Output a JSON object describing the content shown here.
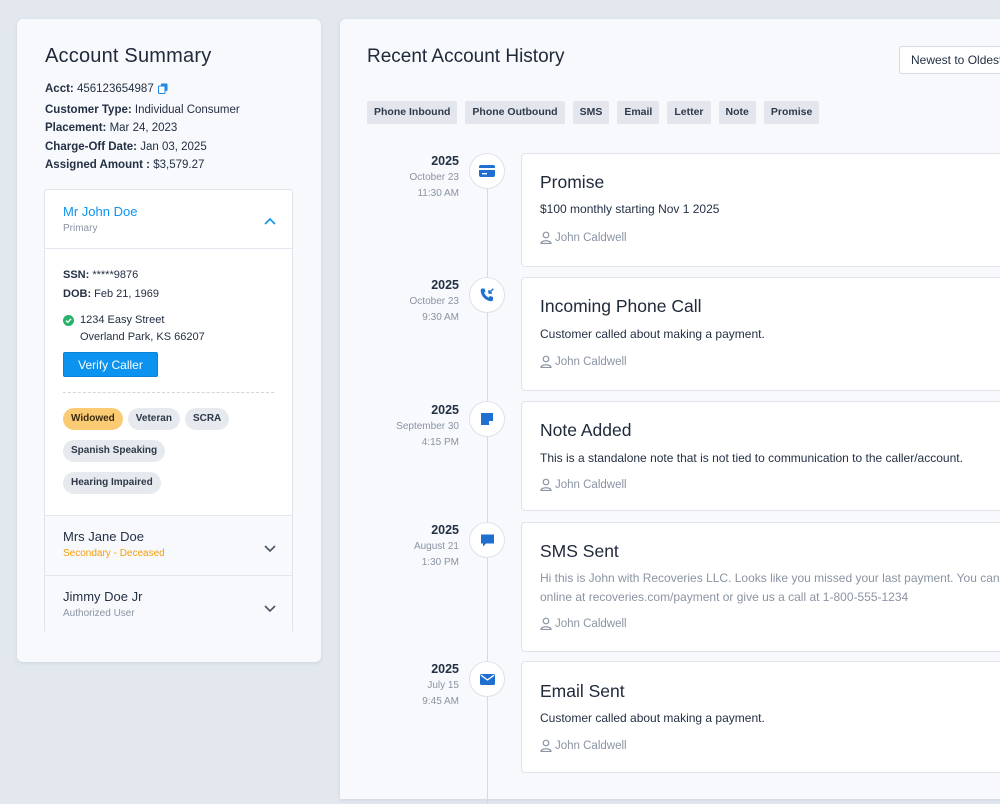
{
  "summary": {
    "title": "Account Summary",
    "acct_label": "Acct:",
    "acct_value": "456123654987",
    "customer_type_label": "Customer Type:",
    "customer_type_value": "Individual Consumer",
    "placement_label": "Placement:",
    "placement_value": "Mar 24, 2023",
    "chargeoff_label": "Charge-Off Date:",
    "chargeoff_value": "Jan 03, 2025",
    "assigned_label": "Assigned Amount :",
    "assigned_value": "$3,579.27"
  },
  "contacts": {
    "primary": {
      "name": "Mr John Doe",
      "role": "Primary",
      "ssn_label": "SSN:",
      "ssn_value": "*****9876",
      "dob_label": "DOB:",
      "dob_value": "Feb 21, 1969",
      "address_line1": "1234 Easy Street",
      "address_line2": "Overland Park, KS 66207",
      "verify_label": "Verify Caller",
      "tags": [
        "Widowed",
        "Veteran",
        "SCRA",
        "Spanish Speaking",
        "Hearing Impaired"
      ]
    },
    "secondary": {
      "name": "Mrs Jane Doe",
      "role": "Secondary - Deceased"
    },
    "authorized": {
      "name": "Jimmy Doe Jr",
      "role": "Authorized User"
    }
  },
  "history": {
    "title": "Recent Account History",
    "sort_label": "Newest to Oldest",
    "filters": [
      "Phone Inbound",
      "Phone Outbound",
      "SMS",
      "Email",
      "Letter",
      "Note",
      "Promise"
    ],
    "events": [
      {
        "year": "2025",
        "date": "October 23",
        "time": "11:30 AM",
        "icon": "credit-card-icon",
        "title": "Promise",
        "desc": "$100 monthly starting Nov 1 2025",
        "desc2": "",
        "user": "John Caldwell"
      },
      {
        "year": "2025",
        "date": "October 23",
        "time": "9:30 AM",
        "icon": "phone-incoming-icon",
        "title": "Incoming Phone Call",
        "desc": "Customer called about making a payment.",
        "desc2": "",
        "user": "John Caldwell"
      },
      {
        "year": "2025",
        "date": "September 30",
        "time": "4:15 PM",
        "icon": "sticky-note-icon",
        "title": "Note Added",
        "desc": "This is a standalone note that is not tied to communication to the caller/account.",
        "desc2": "",
        "user": "John Caldwell"
      },
      {
        "year": "2025",
        "date": "August 21",
        "time": "1:30 PM",
        "icon": "chat-bubble-icon",
        "title": "SMS Sent",
        "desc": "Hi this is John with Recoveries LLC. Looks like you missed your last payment. You can pay",
        "desc2": "online at recoveries.com/payment or give us a call at 1-800-555-1234",
        "user": "John Caldwell"
      },
      {
        "year": "2025",
        "date": "July 15",
        "time": "9:45 AM",
        "icon": "envelope-icon",
        "title": "Email Sent",
        "desc": "Customer called about making a payment.",
        "desc2": "",
        "user": "John Caldwell"
      }
    ]
  },
  "colors": {
    "accent": "#0c93f0",
    "warning": "#f59e0b",
    "success": "#27b36a",
    "tag_warn": "#fbcb73"
  }
}
